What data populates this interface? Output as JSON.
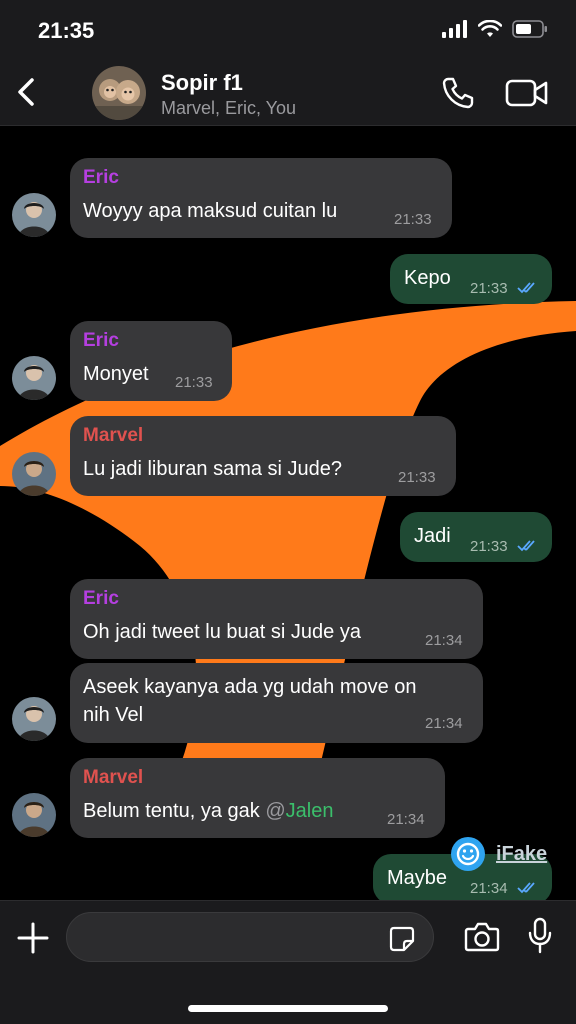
{
  "status_bar": {
    "time": "21:35"
  },
  "header": {
    "title": "Sopir f1",
    "subtitle": "Marvel, Eric, You"
  },
  "colors": {
    "eric": "#b53fe0",
    "marvel": "#e0524f",
    "incoming": "#38383a",
    "outgoing": "#1f4a34",
    "wallpaper_accent": "#ff7a1a"
  },
  "messages": [
    {
      "sender": "Eric",
      "text": "Woyyy apa maksud cuitan lu",
      "time": "21:33"
    },
    {
      "text": "Kepo",
      "time": "21:33"
    },
    {
      "sender": "Eric",
      "text": "Monyet",
      "time": "21:33"
    },
    {
      "sender": "Marvel",
      "text": "Lu jadi liburan sama si Jude?",
      "time": "21:33"
    },
    {
      "text": "Jadi",
      "time": "21:33"
    },
    {
      "sender": "Eric",
      "text": "Oh jadi tweet lu buat si Jude ya",
      "time": "21:34"
    },
    {
      "text_line1": "Aseek kayanya ada yg udah move on",
      "text_line2": "nih Vel",
      "time": "21:34"
    },
    {
      "sender": "Marvel",
      "text": "Belum tentu, ya gak",
      "mention_at": "@",
      "mention_name": "Jalen",
      "time": "21:34"
    },
    {
      "text": "Maybe",
      "time": "21:34"
    }
  ],
  "watermark": {
    "label": "iFake"
  }
}
